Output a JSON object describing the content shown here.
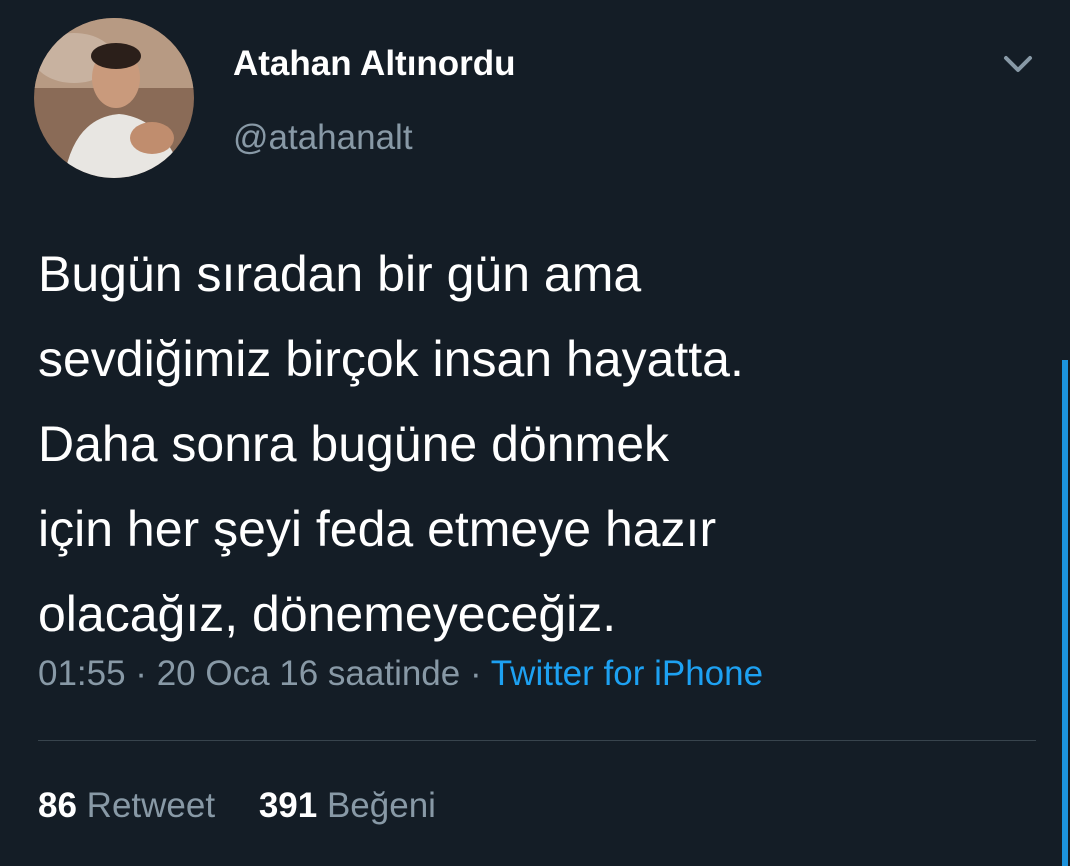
{
  "tweet": {
    "author_name": "Atahan Altınordu",
    "author_handle": "@atahanalt",
    "text_lines": [
      "Bugün sıradan bir gün ama",
      "sevdiğimiz birçok insan hayatta.",
      "Daha sonra bugüne dönmek",
      "için her şeyi feda etmeye hazır",
      "olacağız, dönemeyeceğiz."
    ],
    "timestamp": "01:55 · 20 Oca 16 saatinde",
    "separator": " · ",
    "source": "Twitter for iPhone",
    "retweet_count": "86",
    "retweet_label": "Retweet",
    "like_count": "391",
    "like_label": "Beğeni"
  },
  "icons": {
    "menu": "chevron-down-icon",
    "avatar": "avatar"
  },
  "colors": {
    "background": "#141d26",
    "primary_text": "#ffffff",
    "secondary_text": "#8899a6",
    "accent": "#1da1f2",
    "divider": "#38444d"
  }
}
